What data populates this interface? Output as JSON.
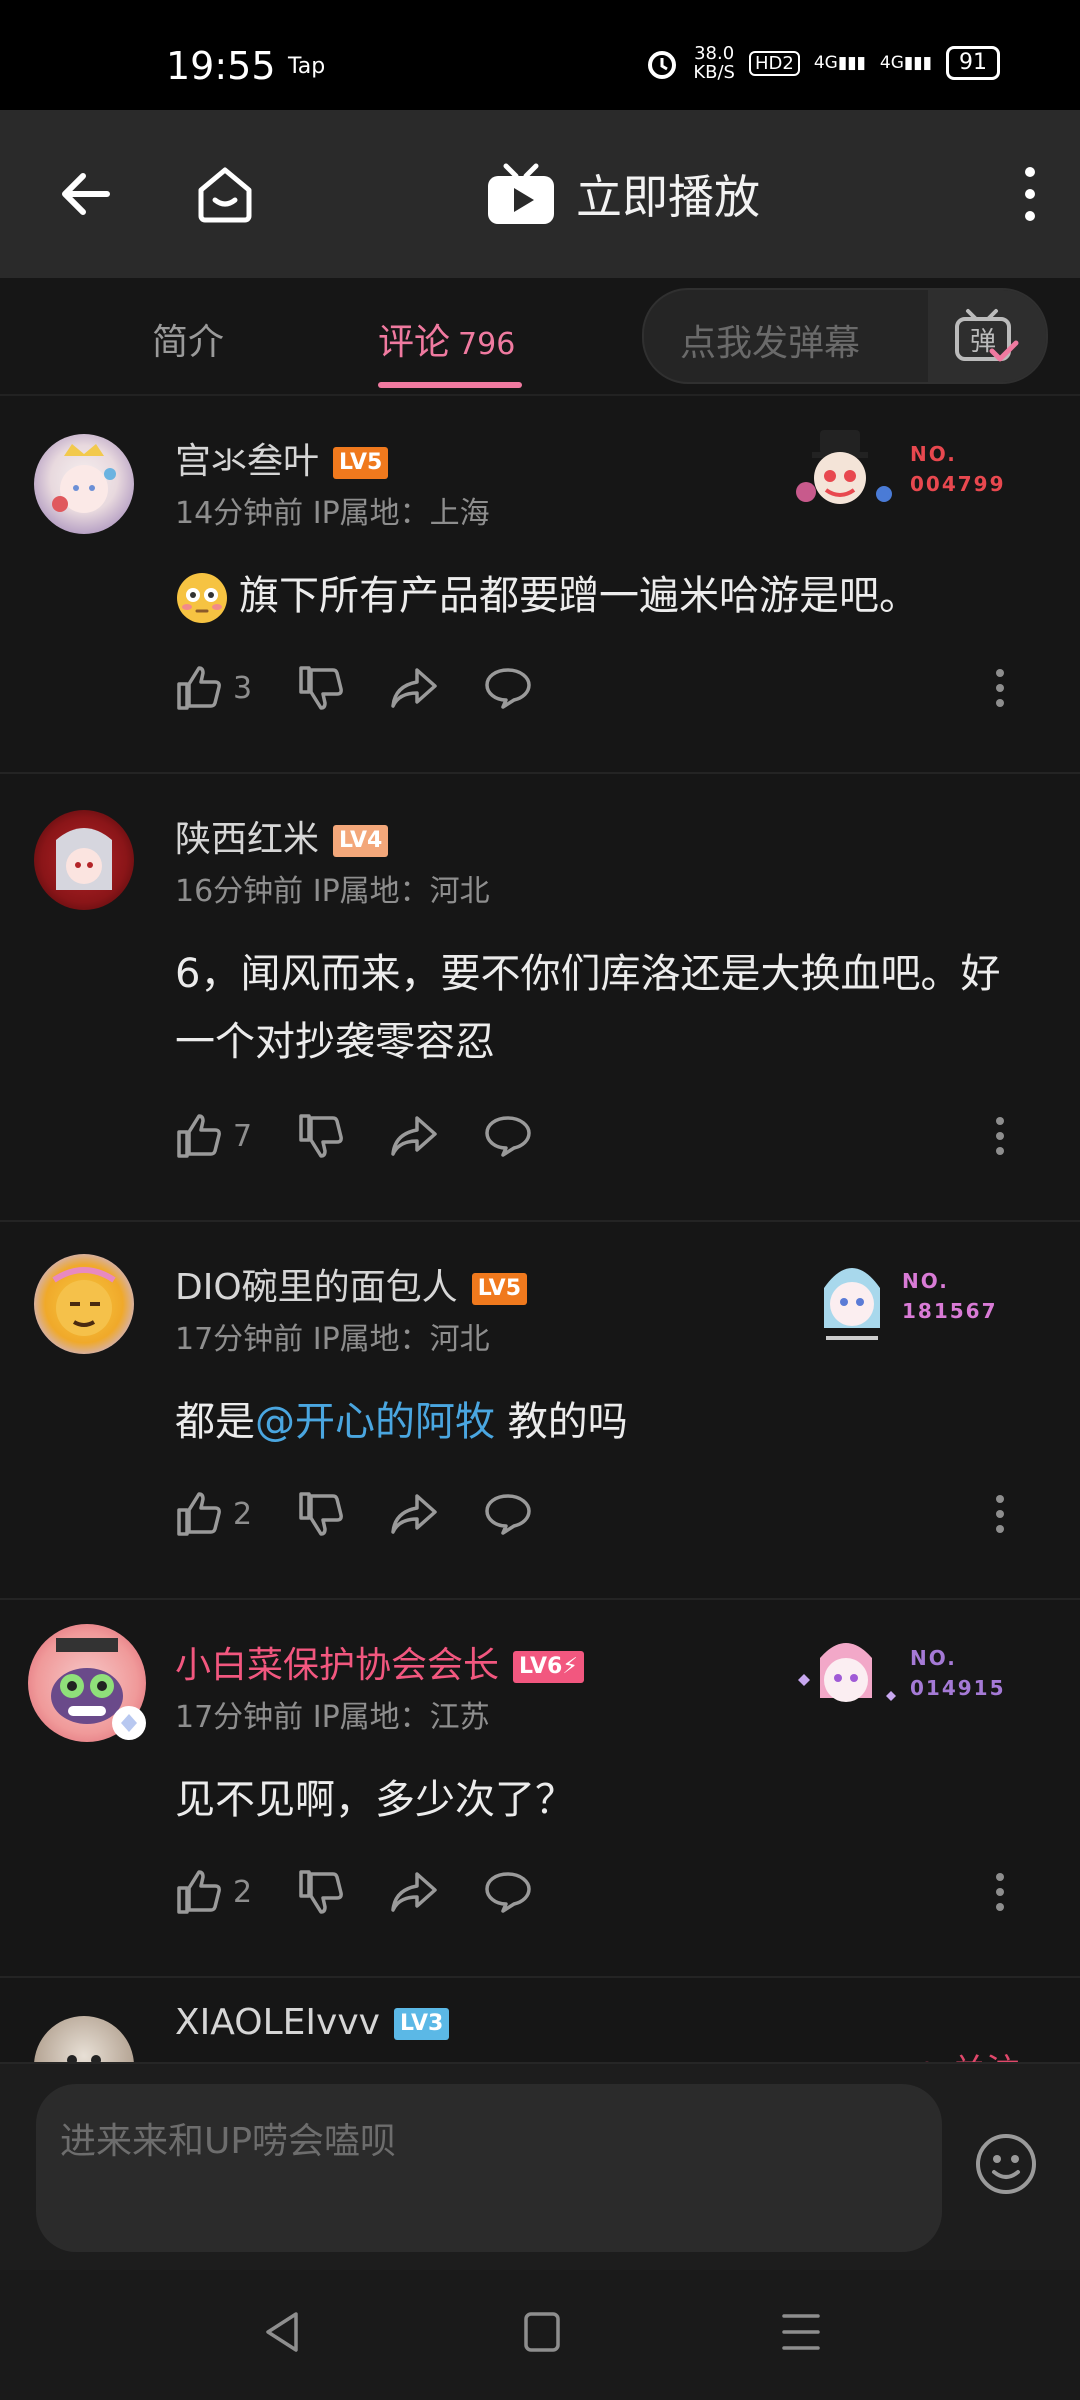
{
  "status_bar": {
    "time": "19:55",
    "app_tag": "Tap",
    "speed_value": "38.0",
    "speed_unit": "KB/S",
    "hd": "HD2",
    "net1": "4G",
    "net2": "4G",
    "battery": "91"
  },
  "header": {
    "back_icon": "back-arrow-icon",
    "home_icon": "home-icon",
    "play_label": "立即播放",
    "more_icon": "more-vertical-icon"
  },
  "tabs": {
    "intro": "简介",
    "comments": "评论",
    "comments_count": "796"
  },
  "danmaku": {
    "placeholder": "点我发弹幕",
    "button_char": "弹"
  },
  "comments": [
    {
      "name": "宫氺叁叶",
      "level": "LV5",
      "level_color": "#f0791d",
      "time": "14分钟前",
      "ip": "IP属地：上海",
      "text": "旗下所有产品都要蹭一遍米哈游是吧。",
      "has_emoji": true,
      "likes": "3",
      "badge_label": "NO.",
      "badge_number": "004799",
      "badge_color": "#e8484f",
      "vip": false
    },
    {
      "name": "陕西红米",
      "level": "LV4",
      "level_color": "#f3a77a",
      "time": "16分钟前",
      "ip": "IP属地：河北",
      "text": "6，闻风而来，要不你们库洛还是大换血吧。好一个对抄袭零容忍",
      "likes": "7",
      "vip": false
    },
    {
      "name": "DIO碗里的面包人",
      "level": "LV5",
      "level_color": "#f0791d",
      "time": "17分钟前",
      "ip": "IP属地：河北",
      "text_before": "都是",
      "mention": "@开心的阿牧",
      "text_after": " 教的吗",
      "likes": "2",
      "badge_label": "NO.",
      "badge_number": "181567",
      "badge_color": "#d97bd6",
      "vip": false
    },
    {
      "name": "小白菜保护协会会长",
      "level": "LV6⚡",
      "level_color": "#f2577f",
      "time": "17分钟前",
      "ip": "IP属地：江苏",
      "text": "见不见啊，多少次了？",
      "likes": "2",
      "badge_label": "NO.",
      "badge_number": "014915",
      "badge_color": "#a57ad6",
      "vip": true
    },
    {
      "name": "XIAOLEIvvv",
      "level": "LV3",
      "level_color": "#5bb8e6",
      "follow": "+ 关注"
    }
  ],
  "input": {
    "placeholder": "进来来和UP唠会嗑呗",
    "emoji_icon": "smiley-icon"
  },
  "nav": {
    "back": "nav-back-icon",
    "home": "nav-home-icon",
    "menu": "nav-menu-icon"
  }
}
